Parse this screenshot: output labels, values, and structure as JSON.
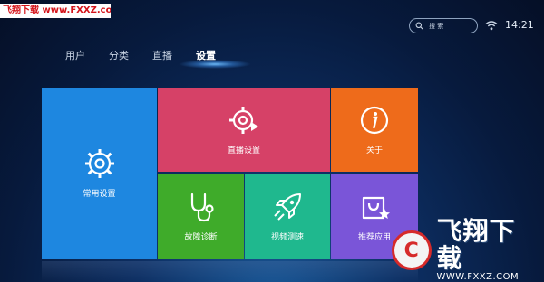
{
  "watermark_top": "飞翔下载 www.FXXZ.com",
  "status_bar": {
    "search_label": "搜 索",
    "time": "14:21"
  },
  "tabs": [
    {
      "label": "用户"
    },
    {
      "label": "分类"
    },
    {
      "label": "直播"
    },
    {
      "label": "设置",
      "active": true
    }
  ],
  "tiles": {
    "common_settings": {
      "label": "常用设置",
      "icon": "gear-icon",
      "color": "#1e87e0"
    },
    "live_settings": {
      "label": "直播设置",
      "icon": "gear-play-icon",
      "color": "#d64167"
    },
    "about": {
      "label": "关于",
      "icon": "info-icon",
      "color": "#ee6b1b"
    },
    "diagnosis": {
      "label": "故障诊断",
      "icon": "stethoscope-icon",
      "color": "#3fab2a"
    },
    "speed_test": {
      "label": "视频测速",
      "icon": "rocket-icon",
      "color": "#1fb88e"
    },
    "recommend": {
      "label": "推荐应用",
      "icon": "shopping-bag-star-icon",
      "color": "#7a55d8"
    }
  },
  "logo_watermark": {
    "name": "飞翔下载",
    "url": "WWW.FXXZ.COM"
  }
}
